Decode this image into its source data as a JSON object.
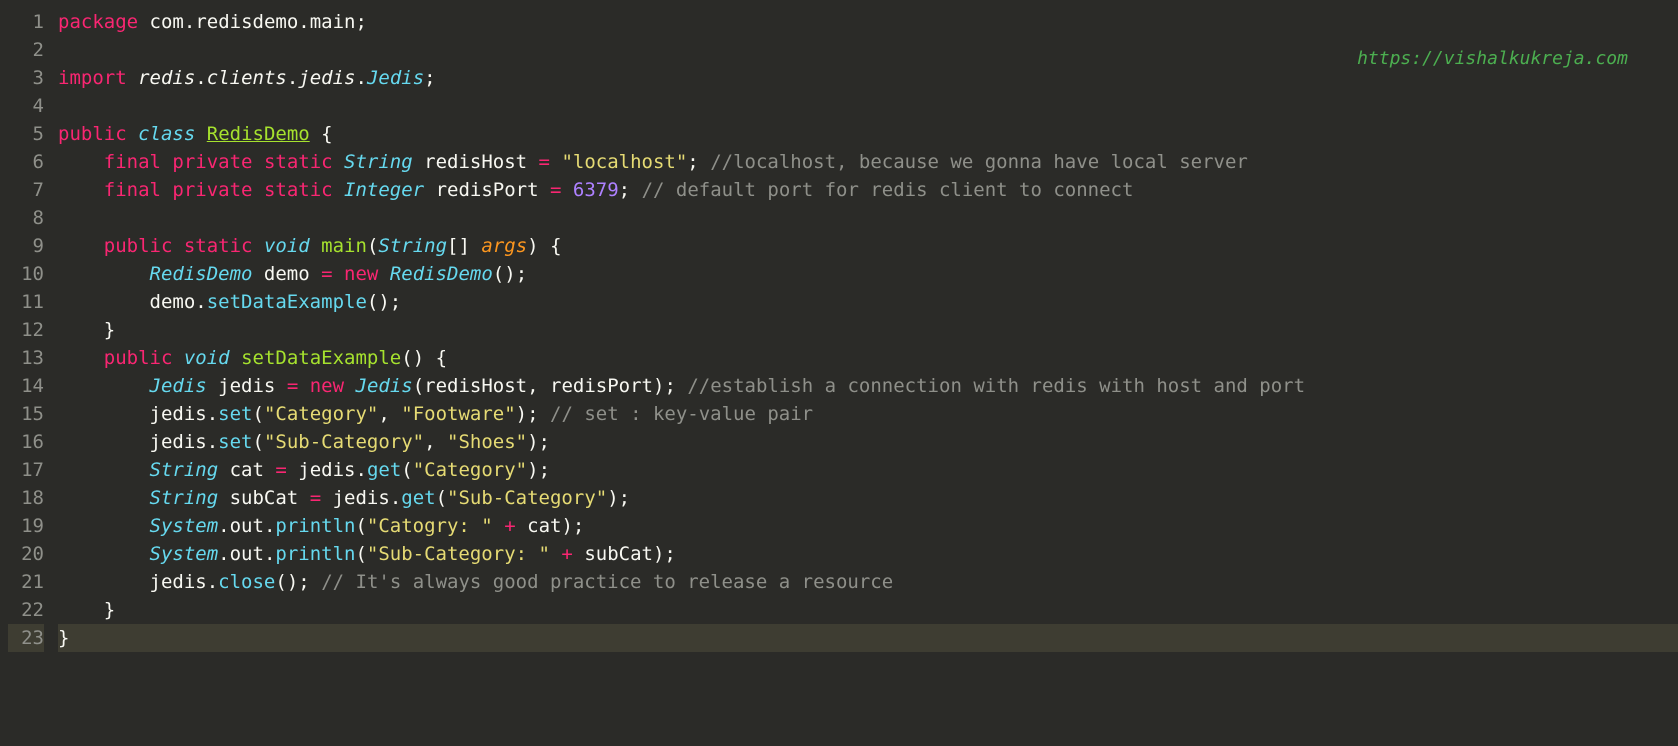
{
  "watermark": "https://vishalkukreja.com",
  "lines": {
    "l1": {
      "num": "1"
    },
    "l2": {
      "num": "2"
    },
    "l3": {
      "num": "3"
    },
    "l4": {
      "num": "4"
    },
    "l5": {
      "num": "5"
    },
    "l6": {
      "num": "6"
    },
    "l7": {
      "num": "7"
    },
    "l8": {
      "num": "8"
    },
    "l9": {
      "num": "9"
    },
    "l10": {
      "num": "10"
    },
    "l11": {
      "num": "11"
    },
    "l12": {
      "num": "12"
    },
    "l13": {
      "num": "13"
    },
    "l14": {
      "num": "14"
    },
    "l15": {
      "num": "15"
    },
    "l16": {
      "num": "16"
    },
    "l17": {
      "num": "17"
    },
    "l18": {
      "num": "18"
    },
    "l19": {
      "num": "19"
    },
    "l20": {
      "num": "20"
    },
    "l21": {
      "num": "21"
    },
    "l22": {
      "num": "22"
    },
    "l23": {
      "num": "23"
    }
  },
  "tokens": {
    "package": "package",
    "import": "import",
    "public": "public",
    "private": "private",
    "final": "final",
    "static": "static",
    "class": "class",
    "void": "void",
    "new": "new",
    "pkg_com": "com",
    "pkg_redisdemo": "redisdemo",
    "pkg_main": "main",
    "pkg_redis": "redis",
    "pkg_clients": "clients",
    "pkg_jedis": "jedis",
    "type_Jedis": "Jedis",
    "type_String": "String",
    "type_Integer": "Integer",
    "type_System": "System",
    "cls_RedisDemo": "RedisDemo",
    "var_redisHost": "redisHost",
    "var_redisPort": "redisPort",
    "var_demo": "demo",
    "var_jedis": "jedis",
    "var_cat": "cat",
    "var_subCat": "subCat",
    "var_out": "out",
    "var_args": "args",
    "mth_main": "main",
    "mth_setDataExample": "setDataExample",
    "mth_set": "set",
    "mth_get": "get",
    "mth_println": "println",
    "mth_close": "close",
    "str_localhost": "\"localhost\"",
    "str_Category": "\"Category\"",
    "str_Footware": "\"Footware\"",
    "str_SubCategory": "\"Sub-Category\"",
    "str_Shoes": "\"Shoes\"",
    "str_Catogry": "\"Catogry: \"",
    "str_SubCategoryLabel": "\"Sub-Category: \"",
    "num_6379": "6379",
    "cmt_localhost": "//localhost, because we gonna have local server",
    "cmt_port": "// default port for redis client to connect",
    "cmt_establish": "//establish a connection with redis with host and port",
    "cmt_setkv": "// set : key-value pair",
    "cmt_release": "// It's always good practice to release a resource",
    "dot": ".",
    "semi": ";",
    "comma": ",",
    "space": " ",
    "eq": "=",
    "plus": "+",
    "lbrace": "{",
    "rbrace": "}",
    "lparen": "(",
    "rparen": ")",
    "lbracket": "[",
    "rbracket": "]"
  }
}
